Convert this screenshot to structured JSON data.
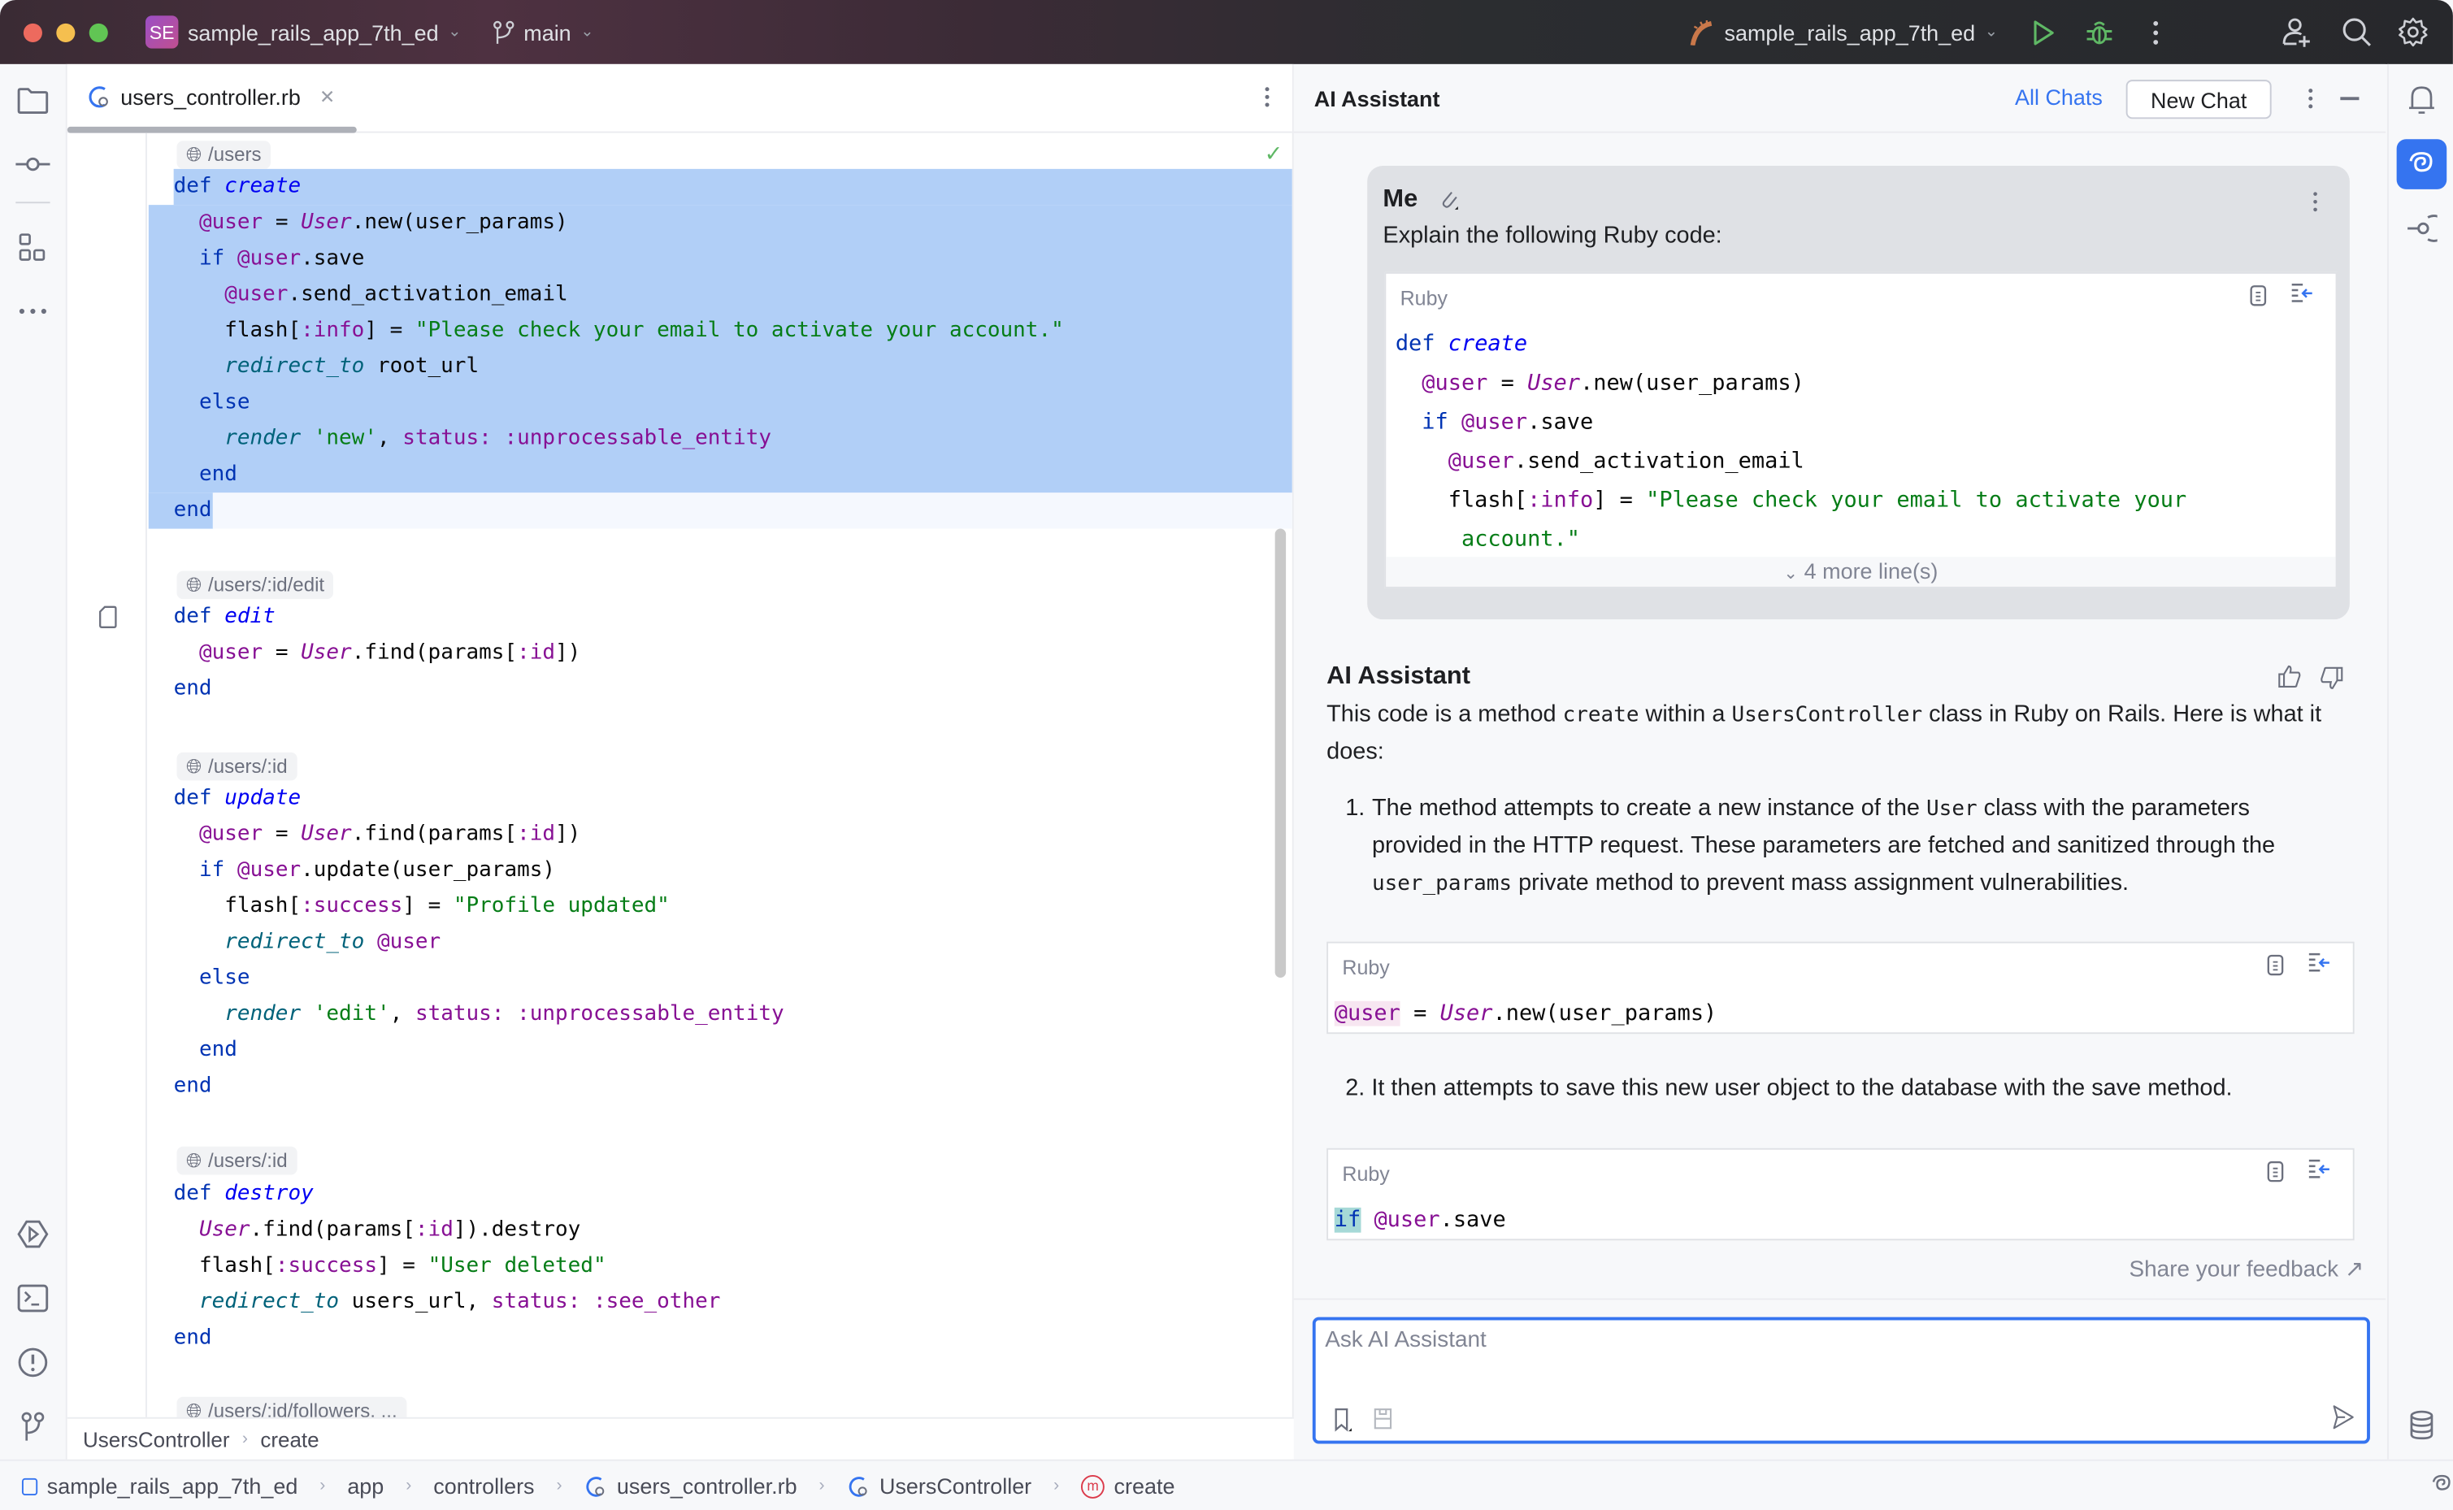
{
  "titlebar": {
    "project_badge": "SE",
    "project_name": "sample_rails_app_7th_ed",
    "branch": "main",
    "run_config": "sample_rails_app_7th_ed",
    "traffic_colors": [
      "#ed6a5e",
      "#f5bf4f",
      "#61c554"
    ]
  },
  "editor": {
    "tab_name": "users_controller.rb",
    "route_hints": [
      "/users",
      "/users/:id/edit",
      "/users/:id",
      "/users/:id",
      "/users/:id/followers, ..."
    ],
    "breadcrumb": [
      "UsersController",
      "create"
    ]
  },
  "code": {
    "create": {
      "def": "def",
      "name": "create",
      "l1": {
        "ivar": "@user",
        "eq": " = ",
        "cls": "User",
        "rest": ".new(user_params)"
      },
      "l2": {
        "kw": "if",
        "ivar": "@user",
        "rest": ".save"
      },
      "l3": {
        "ivar": "@user",
        "rest": ".send_activation_email"
      },
      "l4": {
        "a": "flash[",
        "sym": ":info",
        "b": "] = ",
        "str": "\"Please check your email to activate your account.\""
      },
      "l5": {
        "mth": "redirect_to",
        "rest": " root_url"
      },
      "l6": "else",
      "l7": {
        "mth": "render",
        "str": " 'new'",
        "comma": ", ",
        "key": "status:",
        "sym": " :unprocessable_entity"
      },
      "l8": "end",
      "l9": "end"
    },
    "edit": {
      "def": "def",
      "name": "edit",
      "l1": {
        "ivar": "@user",
        "eq": " = ",
        "cls": "User",
        "a": ".find(params[",
        "sym": ":id",
        "b": "])"
      },
      "end": "end"
    },
    "update": {
      "def": "def",
      "name": "update",
      "l1": {
        "ivar": "@user",
        "eq": " = ",
        "cls": "User",
        "a": ".find(params[",
        "sym": ":id",
        "b": "])"
      },
      "l2": {
        "kw": "if",
        "ivar": "@user",
        "rest": ".update(user_params)"
      },
      "l3": {
        "a": "flash[",
        "sym": ":success",
        "b": "] = ",
        "str": "\"Profile updated\""
      },
      "l4": {
        "mth": "redirect_to",
        "ivar": " @user"
      },
      "l5": "else",
      "l6": {
        "mth": "render",
        "str": " 'edit'",
        "comma": ", ",
        "key": "status:",
        "sym": " :unprocessable_entity"
      },
      "l7": "end",
      "end": "end"
    },
    "destroy": {
      "def": "def",
      "name": "destroy",
      "l1": {
        "cls": "User",
        "a": ".find(params[",
        "sym": ":id",
        "b": "]).destroy"
      },
      "l2": {
        "a": "flash[",
        "sym": ":success",
        "b": "] = ",
        "str": "\"User deleted\""
      },
      "l3": {
        "mth": "redirect_to",
        "a": " users_url, ",
        "key": "status:",
        "sym": " :see_other"
      },
      "end": "end"
    }
  },
  "ai": {
    "title": "AI Assistant",
    "all_chats": "All Chats",
    "new_chat": "New Chat",
    "me_label": "Me",
    "me_prompt": "Explain the following Ruby code:",
    "code_lang": "Ruby",
    "me_code": {
      "l0a": "def",
      "l0b": "create",
      "l1": {
        "ivar": "@user",
        "eq": " = ",
        "cls": "User",
        "rest": ".new(user_params)"
      },
      "l2": {
        "kw": "if",
        "ivar": "@user",
        "rest": ".save"
      },
      "l3": {
        "ivar": "@user",
        "rest": ".send_activation_email"
      },
      "l4": {
        "a": "flash[",
        "sym": ":info",
        "b": "] = ",
        "str": "\"Please check your email to activate your"
      },
      "l5": "account.\""
    },
    "more_lines": "4 more line(s)",
    "assistant_label": "AI Assistant",
    "intro_a": "This code is a method ",
    "intro_code1": "create",
    "intro_b": " within a ",
    "intro_code2": "UsersController",
    "intro_c": " class in Ruby on Rails. Here is what it does:",
    "step1_num": "1.",
    "step1_a": "The method attempts to create a new instance of the ",
    "step1_code": "User",
    "step1_b": " class with the parameters provided in the HTTP request. These parameters are fetched and sanitized through the ",
    "step1_code2": "user_params",
    "step1_c": " private method to prevent mass assignment vulnerabilities.",
    "snippet1": {
      "ivar": "@user",
      "eq": " = ",
      "cls": "User",
      "rest": ".new(user_params)"
    },
    "step2": "2. It then attempts to save this new user object to the database with the save method.",
    "snippet2": {
      "kw": "if",
      "ivar": "@user",
      "rest": ".save"
    },
    "feedback": "Share your feedback ↗",
    "input_placeholder": "Ask AI Assistant"
  },
  "statusbar": {
    "path": [
      "sample_rails_app_7th_ed",
      "app",
      "controllers",
      "users_controller.rb",
      "UsersController",
      "create"
    ]
  },
  "colors": {
    "accent": "#3574f0",
    "selection": "#b1cff7",
    "run_green": "#5fb865"
  }
}
